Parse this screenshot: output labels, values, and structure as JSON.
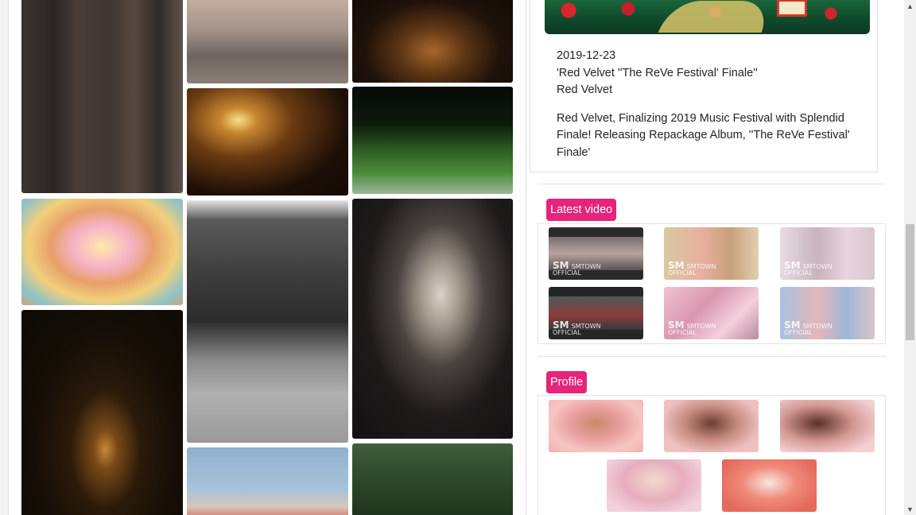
{
  "news": {
    "date": "2019-12-23",
    "title": "'Red Velvet ''The ReVe Festival' Finale''",
    "artist": "Red Velvet",
    "body": "Red Velvet, Finalizing 2019 Music Festival with Splendid Finale! Releasing Repackage Album, ''The ReVe Festival' Finale'"
  },
  "sections": {
    "latest_video_label": "Latest video",
    "profile_label": "Profile"
  },
  "video_watermark": {
    "logo": "SM",
    "line1": "SMTOWN",
    "line2": "OFFICIAL"
  },
  "colors": {
    "badge": "#e5247a"
  }
}
